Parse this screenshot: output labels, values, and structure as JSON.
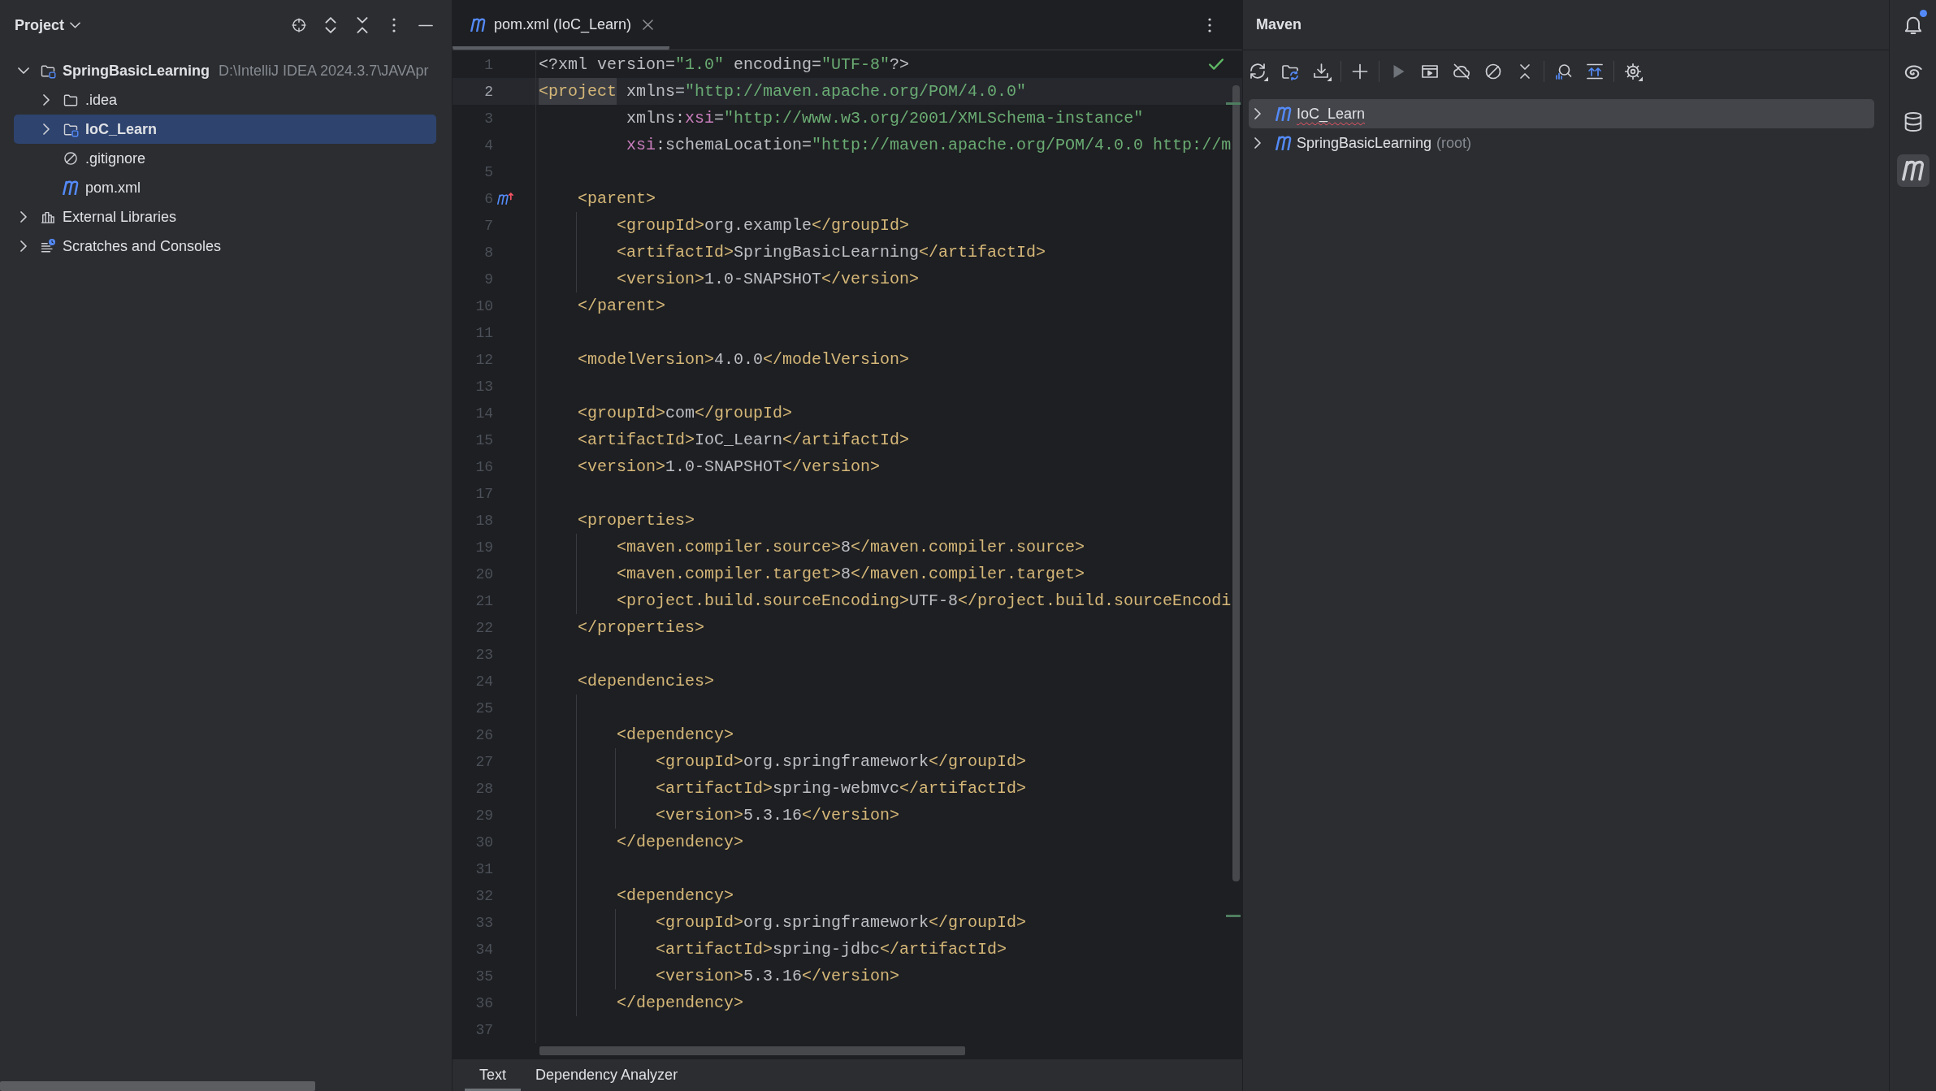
{
  "project_panel": {
    "title": "Project",
    "tree": [
      {
        "label": "SpringBasicLearning",
        "kind": "module",
        "path": "D:\\IntelliJ IDEA 2024.3.7\\JAVApr",
        "expanded": true,
        "selected": false,
        "children": [
          {
            "label": ".idea",
            "kind": "folder",
            "expanded": false,
            "selected": false
          },
          {
            "label": "IoC_Learn",
            "kind": "module",
            "expanded": false,
            "selected": true
          },
          {
            "label": ".gitignore",
            "kind": "ignore_file",
            "selected": false
          },
          {
            "label": "pom.xml",
            "kind": "maven_file",
            "selected": false
          }
        ]
      },
      {
        "label": "External Libraries",
        "kind": "libraries",
        "expanded": false,
        "selected": false
      },
      {
        "label": "Scratches and Consoles",
        "kind": "scratches",
        "expanded": false,
        "selected": false
      }
    ]
  },
  "editor": {
    "tabs": [
      {
        "label": "pom.xml (IoC_Learn)",
        "selected": true
      }
    ],
    "lines": [
      {
        "number": "1",
        "current": false,
        "tokens": [
          {
            "kind": "text",
            "text": "<?xml version="
          },
          {
            "kind": "value",
            "text": "\"1.0\""
          },
          {
            "kind": "text",
            "text": " encoding="
          },
          {
            "kind": "value",
            "text": "\"UTF-8\""
          },
          {
            "kind": "text",
            "text": "?>"
          }
        ]
      },
      {
        "number": "2",
        "current": true,
        "tokens": [
          {
            "kind": "matched_tag",
            "text": "<project"
          },
          {
            "kind": "attr",
            "text": " xmlns="
          },
          {
            "kind": "value",
            "text": "\"http://maven.apache.org/POM/4.0.0\""
          }
        ]
      },
      {
        "number": "3",
        "current": false,
        "tokens": [
          {
            "kind": "attr",
            "text": "         xmlns:"
          },
          {
            "kind": "ns",
            "text": "xsi"
          },
          {
            "kind": "attr",
            "text": "="
          },
          {
            "kind": "value",
            "text": "\"http://www.w3.org/2001/XMLSchema-instance\""
          }
        ]
      },
      {
        "number": "4",
        "current": false,
        "tokens": [
          {
            "kind": "ns",
            "text": "         xsi"
          },
          {
            "kind": "attr",
            "text": ":schemaLocation="
          },
          {
            "kind": "value",
            "text": "\"http://maven.apache.org/POM/4.0.0 http://m"
          }
        ]
      },
      {
        "number": "5",
        "current": false
      },
      {
        "number": "6",
        "current": false,
        "gutter_icon": true,
        "tokens": [
          {
            "kind": "tag",
            "text": "    <parent>"
          }
        ]
      },
      {
        "number": "7",
        "current": false,
        "tokens": [
          {
            "kind": "tag",
            "text": "        <groupId>"
          },
          {
            "kind": "text",
            "text": "org.example"
          },
          {
            "kind": "tag",
            "text": "</groupId>"
          }
        ]
      },
      {
        "number": "8",
        "current": false,
        "tokens": [
          {
            "kind": "tag",
            "text": "        <artifactId>"
          },
          {
            "kind": "text",
            "text": "SpringBasicLearning"
          },
          {
            "kind": "tag",
            "text": "</artifactId>"
          }
        ]
      },
      {
        "number": "9",
        "current": false,
        "tokens": [
          {
            "kind": "tag",
            "text": "        <version>"
          },
          {
            "kind": "text",
            "text": "1.0-SNAPSHOT"
          },
          {
            "kind": "tag",
            "text": "</version>"
          }
        ]
      },
      {
        "number": "10",
        "current": false,
        "tokens": [
          {
            "kind": "tag",
            "text": "    </parent>"
          }
        ]
      },
      {
        "number": "11",
        "current": false
      },
      {
        "number": "12",
        "current": false,
        "tokens": [
          {
            "kind": "tag",
            "text": "    <modelVersion>"
          },
          {
            "kind": "text",
            "text": "4.0.0"
          },
          {
            "kind": "tag",
            "text": "</modelVersion>"
          }
        ]
      },
      {
        "number": "13",
        "current": false
      },
      {
        "number": "14",
        "current": false,
        "tokens": [
          {
            "kind": "tag",
            "text": "    <groupId>"
          },
          {
            "kind": "text",
            "text": "com"
          },
          {
            "kind": "tag",
            "text": "</groupId>"
          }
        ]
      },
      {
        "number": "15",
        "current": false,
        "tokens": [
          {
            "kind": "tag",
            "text": "    <artifactId>"
          },
          {
            "kind": "text",
            "text": "IoC_Learn"
          },
          {
            "kind": "tag",
            "text": "</artifactId>"
          }
        ]
      },
      {
        "number": "16",
        "current": false,
        "tokens": [
          {
            "kind": "tag",
            "text": "    <version>"
          },
          {
            "kind": "text",
            "text": "1.0-SNAPSHOT"
          },
          {
            "kind": "tag",
            "text": "</version>"
          }
        ]
      },
      {
        "number": "17",
        "current": false
      },
      {
        "number": "18",
        "current": false,
        "tokens": [
          {
            "kind": "tag",
            "text": "    <properties>"
          }
        ]
      },
      {
        "number": "19",
        "current": false,
        "tokens": [
          {
            "kind": "tag",
            "text": "        <maven.compiler.source>"
          },
          {
            "kind": "text",
            "text": "8"
          },
          {
            "kind": "tag",
            "text": "</maven.compiler.source>"
          }
        ]
      },
      {
        "number": "20",
        "current": false,
        "tokens": [
          {
            "kind": "tag",
            "text": "        <maven.compiler.target>"
          },
          {
            "kind": "text",
            "text": "8"
          },
          {
            "kind": "tag",
            "text": "</maven.compiler.target>"
          }
        ]
      },
      {
        "number": "21",
        "current": false,
        "tokens": [
          {
            "kind": "tag",
            "text": "        <project.build.sourceEncoding>"
          },
          {
            "kind": "text",
            "text": "UTF-8"
          },
          {
            "kind": "tag",
            "text": "</project.build.sourceEncodi"
          }
        ]
      },
      {
        "number": "22",
        "current": false,
        "tokens": [
          {
            "kind": "tag",
            "text": "    </properties>"
          }
        ]
      },
      {
        "number": "23",
        "current": false
      },
      {
        "number": "24",
        "current": false,
        "tokens": [
          {
            "kind": "tag",
            "text": "    <dependencies>"
          }
        ]
      },
      {
        "number": "25",
        "current": false
      },
      {
        "number": "26",
        "current": false,
        "tokens": [
          {
            "kind": "tag",
            "text": "        <dependency>"
          }
        ]
      },
      {
        "number": "27",
        "current": false,
        "tokens": [
          {
            "kind": "tag",
            "text": "            <groupId>"
          },
          {
            "kind": "text",
            "text": "org.springframework"
          },
          {
            "kind": "tag",
            "text": "</groupId>"
          }
        ]
      },
      {
        "number": "28",
        "current": false,
        "tokens": [
          {
            "kind": "tag",
            "text": "            <artifactId>"
          },
          {
            "kind": "text",
            "text": "spring-webmvc"
          },
          {
            "kind": "tag",
            "text": "</artifactId>"
          }
        ]
      },
      {
        "number": "29",
        "current": false,
        "tokens": [
          {
            "kind": "tag",
            "text": "            <version>"
          },
          {
            "kind": "text",
            "text": "5.3.16"
          },
          {
            "kind": "tag",
            "text": "</version>"
          }
        ]
      },
      {
        "number": "30",
        "current": false,
        "tokens": [
          {
            "kind": "tag",
            "text": "        </dependency>"
          }
        ]
      },
      {
        "number": "31",
        "current": false
      },
      {
        "number": "32",
        "current": false,
        "tokens": [
          {
            "kind": "tag",
            "text": "        <dependency>"
          }
        ]
      },
      {
        "number": "33",
        "current": false,
        "tokens": [
          {
            "kind": "tag",
            "text": "            <groupId>"
          },
          {
            "kind": "text",
            "text": "org.springframework"
          },
          {
            "kind": "tag",
            "text": "</groupId>"
          }
        ]
      },
      {
        "number": "34",
        "current": false,
        "tokens": [
          {
            "kind": "tag",
            "text": "            <artifactId>"
          },
          {
            "kind": "text",
            "text": "spring-jdbc"
          },
          {
            "kind": "tag",
            "text": "</artifactId>"
          }
        ]
      },
      {
        "number": "35",
        "current": false,
        "tokens": [
          {
            "kind": "tag",
            "text": "            <version>"
          },
          {
            "kind": "text",
            "text": "5.3.16"
          },
          {
            "kind": "tag",
            "text": "</version>"
          }
        ]
      },
      {
        "number": "36",
        "current": false,
        "tokens": [
          {
            "kind": "tag",
            "text": "        </dependency>"
          }
        ]
      },
      {
        "number": "37",
        "current": false
      }
    ],
    "mode_tabs": [
      {
        "label": "Text",
        "selected": true
      },
      {
        "label": "Dependency Analyzer",
        "selected": false
      }
    ]
  },
  "maven_panel": {
    "title": "Maven",
    "toolbar": [
      {
        "kind": "reload",
        "disabled": false
      },
      {
        "kind": "folder_reload",
        "disabled": false
      },
      {
        "kind": "download",
        "disabled": false
      },
      {
        "kind": "separator"
      },
      {
        "kind": "add",
        "disabled": false
      },
      {
        "kind": "separator"
      },
      {
        "kind": "run",
        "disabled": true
      },
      {
        "kind": "run_config",
        "disabled": false
      },
      {
        "kind": "offline",
        "disabled": false
      },
      {
        "kind": "skip_tests",
        "disabled": false
      },
      {
        "kind": "collapse",
        "disabled": false
      },
      {
        "kind": "separator"
      },
      {
        "kind": "analyze",
        "disabled": false
      },
      {
        "kind": "show_updates",
        "disabled": false
      },
      {
        "kind": "separator"
      },
      {
        "kind": "settings",
        "disabled": false
      }
    ],
    "tree": [
      {
        "label": "IoC_Learn",
        "expanded": false,
        "selected": true,
        "misspelled": true
      },
      {
        "label": "SpringBasicLearning",
        "note": "(root)",
        "expanded": false,
        "selected": false,
        "misspelled": false
      }
    ]
  },
  "tool_strip": [
    {
      "kind": "notifications",
      "unread": true,
      "selected": false
    },
    {
      "kind": "ai_assistant",
      "selected": false
    },
    {
      "kind": "database",
      "selected": false
    },
    {
      "kind": "maven",
      "selected": true
    }
  ]
}
